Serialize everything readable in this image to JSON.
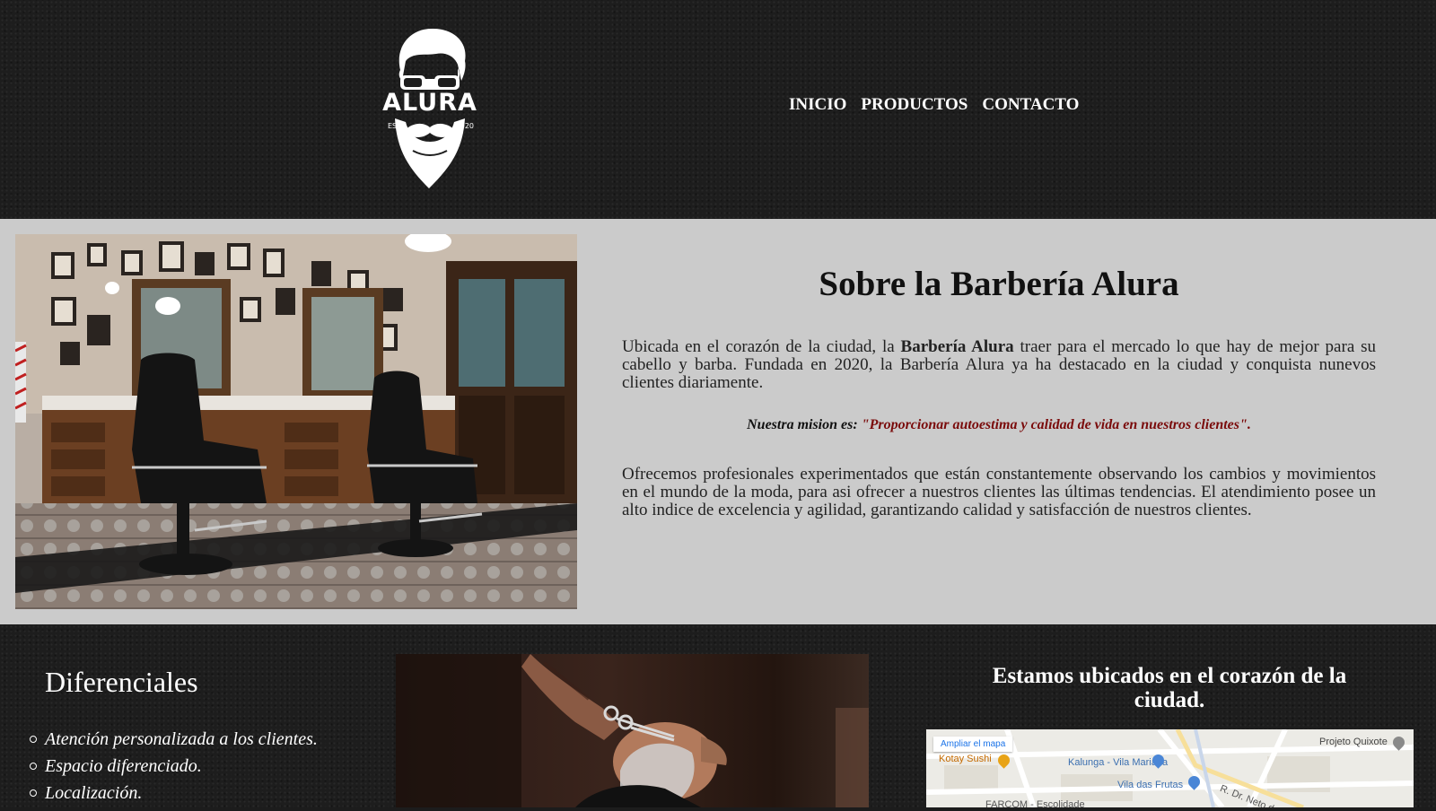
{
  "header": {
    "logo": {
      "brand": "ALURA",
      "est": "ESTD",
      "year": "2020"
    },
    "nav": [
      "INICIO",
      "PRODUCTOS",
      "CONTACTO"
    ]
  },
  "about": {
    "title": "Sobre la Barbería Alura",
    "p1_before": "Ubicada en el corazón de la ciudad, la ",
    "p1_bold": "Barbería Alura",
    "p1_after": " traer para el mercado lo que hay de mejor para su cabello y barba. Fundada en 2020, la Barbería Alura ya ha destacado en la ciudad y conquista nunevos clientes diariamente.",
    "mission_label": "Nuestra mision es:",
    "mission_quote": "\"Proporcionar autoestima y calidad de vida en nuestros clientes\".",
    "p2": "Ofrecemos profesionales experimentados que están constantemente observando los cambios y movimientos en el mundo de la moda, para asi ofrecer a nuestros clientes las últimas tendencias. El atendimiento posee un alto indice de excelencia y agilidad, garantizando calidad y satisfacción de nuestros clientes."
  },
  "diferenciales": {
    "title": "Diferenciales",
    "items": [
      "Atención personalizada a los clientes.",
      "Espacio diferenciado.",
      "Localización."
    ]
  },
  "location": {
    "title": "Estamos ubicados en el corazón de la ciudad.",
    "map_link": "Ampliar el mapa",
    "map_labels": [
      "Projeto Quixote",
      "Kotay Sushi",
      "Kalunga - Vila Mariana",
      "Vila das Frutas",
      "R. Dr. Neto de A",
      "FARCOM - Escolidade"
    ]
  },
  "colors": {
    "dark_bg": "#1d1d1d",
    "about_bg": "#cbcbcb",
    "mission_quote": "#7a0b0b",
    "map_link": "#1a73e8"
  }
}
